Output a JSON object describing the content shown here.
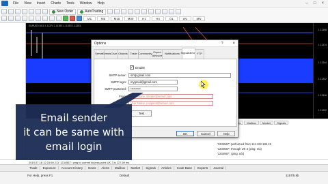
{
  "menu": {
    "items": [
      "File",
      "View",
      "Insert",
      "Charts",
      "Tools",
      "Window",
      "Help"
    ]
  },
  "toolbar": {
    "new_order": "New Order",
    "autotrading": "AutoTrading",
    "timeframes": [
      "M1",
      "M5",
      "M15",
      "M30",
      "H1",
      "H4",
      "D1",
      "W1",
      "MN"
    ]
  },
  "chart": {
    "info": "EURUSD,M15  1.11374 1.11353 1.11353 1.11353",
    "prices": [
      "1.11398",
      "1.11374",
      "1.11344",
      "1.11332",
      "1.11316",
      "1.11302"
    ]
  },
  "dialog": {
    "title": "Options",
    "help_glyph": "?",
    "close_glyph": "×",
    "tabs": [
      "Server",
      "Charts",
      "Objects",
      "Trade",
      "Expert Advisors",
      "Notifications",
      "Email",
      "FTP",
      "Events",
      "Community",
      "Signals"
    ],
    "enable_label": "Enable",
    "enable_checked": true,
    "fields": {
      "smtp_server_label": "SMTP server:",
      "smtp_server_value": "smtp.gmail.com",
      "smtp_login_label": "SMTP login:",
      "smtp_login_value": "mygmail@gmail.com",
      "smtp_password_label": "SMTP password:",
      "smtp_password_value": "••••••••••",
      "from_label": "From:",
      "from_value": "Your Name, sender@server.com",
      "to_label": "To:",
      "to_value": "Your Name, recipient@server.com"
    },
    "test_button": "Test",
    "ok_button": "OK",
    "cancel_button": "Cancel",
    "help_button": "Help"
  },
  "terminal": {
    "tabs": [
      "Alerts",
      "Mailbox",
      "Market",
      "Signals"
    ],
    "rows": [
      "'1234567': performed from 114.122.186.19",
      "'1234567': through UK 3 (ping: n/a)",
      "'1234567': (ping: n/a)"
    ]
  },
  "log_row": "2019.07.18 12:15:50.211   '1234567': ping to current access point UK 3 is 227.69 ms",
  "bottom_tabs": [
    "Trade",
    "Exposure",
    "Account History",
    "News",
    "Alerts",
    "Mailbox",
    "Market",
    "Signals",
    "Articles",
    "Code Base",
    "Experts",
    "Journal"
  ],
  "status": {
    "left": "For Help, press F1",
    "middle": "Default",
    "right": "1157/5 kb"
  },
  "caption": {
    "line1": "Email sender",
    "line2": "it can be same with",
    "line3": "email login"
  }
}
